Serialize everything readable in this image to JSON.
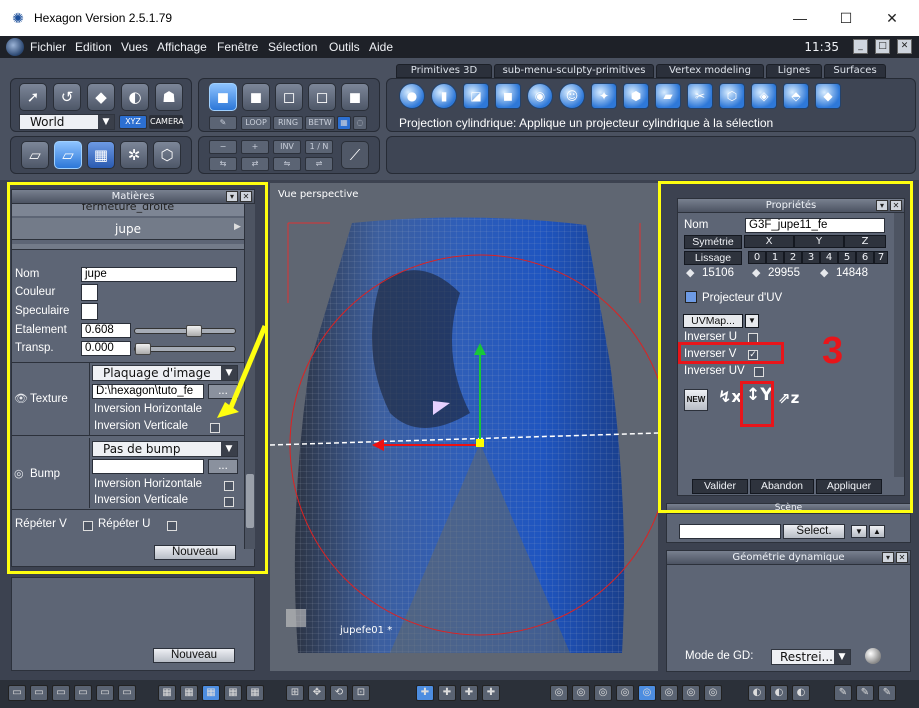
{
  "window": {
    "title": "Hexagon Version 2.5.1.79",
    "min": "—",
    "max": "☐",
    "close": "✕"
  },
  "menu": [
    "Fichier",
    "Edition",
    "Vues",
    "Affichage",
    "Fenêtre",
    "Sélection",
    "Outils",
    "Aide"
  ],
  "clock": "11:35",
  "toolbar": {
    "world": "World",
    "xyz": "XYZ",
    "camera": "CAMERA",
    "loop": "LOOP",
    "ring": "RING",
    "betw": "BETW",
    "minus": "−",
    "plus": "+",
    "inv": "INV",
    "one_n": "1 / N",
    "tabs": [
      "Primitives 3D",
      "sub-menu-sculpty-primitives",
      "Vertex modeling",
      "Lignes",
      "Surfaces"
    ],
    "status": "Projection cylindrique: Applique un projecteur cylindrique à la sélection"
  },
  "materials": {
    "title": "Matières",
    "prev_item": "fermeture_droite",
    "selected": "jupe",
    "nom_label": "Nom",
    "nom_value": "jupe",
    "couleur_label": "Couleur",
    "speculaire_label": "Speculaire",
    "etalement_label": "Etalement",
    "etalement_value": "0.608",
    "etalement_level": 0.61,
    "transp_label": "Transp.",
    "transp_value": "0.000",
    "transp_level": 0.0,
    "texture_label": "Texture",
    "texture_mode": "Plaquage d'image",
    "texture_path": "D:\\hexagon\\tuto_fe",
    "inversion_h": "Inversion Horizontale",
    "inversion_v": "Inversion Verticale",
    "bump_label": "Bump",
    "bump_mode": "Pas de bump",
    "repeter_v": "Répéter V",
    "repeter_u": "Répéter U",
    "nouveau": "Nouveau",
    "browse": "..."
  },
  "nouveau2": "Nouveau",
  "viewport": {
    "label": "Vue perspective",
    "object": "jupefe01 *"
  },
  "props": {
    "title": "Propriétés",
    "nom_label": "Nom",
    "nom_value": "G3F_jupe11_fe",
    "symetrie": "Symétrie",
    "x": "X",
    "y": "Y",
    "z": "Z",
    "lissage": "Lissage",
    "levels": [
      "0",
      "1",
      "2",
      "3",
      "4",
      "5",
      "6",
      "7"
    ],
    "count1": "15106",
    "count2": "29955",
    "count3": "14848",
    "projecteur": "Projecteur d'UV",
    "uvmap": "UVMap...",
    "inverser_u": "Inverser U",
    "inverser_v": "Inverser V",
    "inverser_uv": "Inverser UV",
    "new": "NEW",
    "valider": "Valider",
    "abandon": "Abandon",
    "appliquer": "Appliquer"
  },
  "annotation": "3",
  "scene": {
    "title": "Scène",
    "select": "Select."
  },
  "geodyn": {
    "title": "Géométrie dynamique",
    "mode_label": "Mode de GD:",
    "mode_value": "Restrei..."
  }
}
